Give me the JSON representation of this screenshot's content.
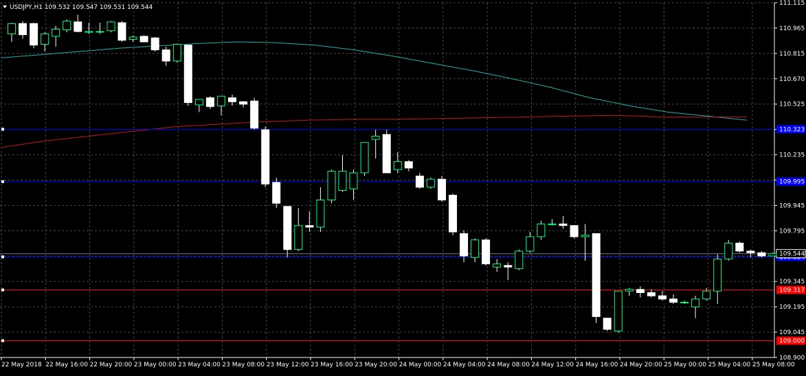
{
  "chart_title": "USDJPY,H1  109.532 109.547 109.531 109.544",
  "colors": {
    "background": "#000000",
    "grid": "#4a4a4a",
    "axis": "#ffffff",
    "text": "#ffffff",
    "bull_body": "#000000",
    "bull_border": "#00ff7f",
    "bear_body": "#ffffff",
    "bear_border": "#ffffff",
    "wick": "#ffffff",
    "ma_fast": "#20b2aa",
    "ma_slow": "#c01818",
    "blue_level": "#0000ff",
    "red_level": "#ff0000",
    "price_line": "#708090"
  },
  "chart_data": {
    "type": "candlestick",
    "symbol": "USDJPY",
    "timeframe": "H1",
    "title": "USDJPY,H1",
    "header_values": [
      "109.532",
      "109.547",
      "109.531",
      "109.544"
    ],
    "y_ticks": [
      "111.115",
      "110.965",
      "110.815",
      "110.670",
      "110.525",
      "110.380",
      "110.235",
      "110.090",
      "109.945",
      "109.795",
      "109.645",
      "109.345",
      "109.195",
      "109.045",
      "108.900"
    ],
    "ylim": [
      108.894,
      111.115
    ],
    "x_ticks": [
      "22 May 2018",
      "22 May 16:00",
      "22 May 20:00",
      "23 May 00:00",
      "23 May 04:00",
      "23 May 08:00",
      "23 May 12:00",
      "23 May 16:00",
      "23 May 20:00",
      "24 May 00:00",
      "24 May 04:00",
      "24 May 08:00",
      "24 May 12:00",
      "24 May 16:00",
      "24 May 20:00",
      "25 May 00:00",
      "25 May 04:00",
      "25 May 08:00"
    ],
    "candles": [
      {
        "o": 110.92,
        "h": 110.99,
        "l": 110.87,
        "c": 110.985
      },
      {
        "o": 110.985,
        "h": 111.0,
        "l": 110.89,
        "c": 110.915
      },
      {
        "o": 110.985,
        "h": 110.99,
        "l": 110.83,
        "c": 110.85
      },
      {
        "o": 110.855,
        "h": 110.93,
        "l": 110.81,
        "c": 110.92
      },
      {
        "o": 110.905,
        "h": 110.97,
        "l": 110.84,
        "c": 110.95
      },
      {
        "o": 110.945,
        "h": 111.01,
        "l": 110.93,
        "c": 111.0
      },
      {
        "o": 110.995,
        "h": 111.04,
        "l": 110.93,
        "c": 110.935
      },
      {
        "o": 110.93,
        "h": 110.99,
        "l": 110.92,
        "c": 110.935
      },
      {
        "o": 110.935,
        "h": 110.99,
        "l": 110.92,
        "c": 110.935
      },
      {
        "o": 110.94,
        "h": 111.0,
        "l": 110.93,
        "c": 110.995
      },
      {
        "o": 110.99,
        "h": 111.0,
        "l": 110.87,
        "c": 110.88
      },
      {
        "o": 110.885,
        "h": 110.91,
        "l": 110.87,
        "c": 110.9
      },
      {
        "o": 110.905,
        "h": 110.91,
        "l": 110.87,
        "c": 110.87
      },
      {
        "o": 110.895,
        "h": 110.9,
        "l": 110.81,
        "c": 110.82
      },
      {
        "o": 110.82,
        "h": 110.84,
        "l": 110.72,
        "c": 110.75
      },
      {
        "o": 110.75,
        "h": 110.86,
        "l": 110.74,
        "c": 110.855
      },
      {
        "o": 110.85,
        "h": 110.85,
        "l": 110.47,
        "c": 110.49
      },
      {
        "o": 110.475,
        "h": 110.51,
        "l": 110.43,
        "c": 110.51
      },
      {
        "o": 110.52,
        "h": 110.53,
        "l": 110.45,
        "c": 110.465
      },
      {
        "o": 110.47,
        "h": 110.53,
        "l": 110.41,
        "c": 110.53
      },
      {
        "o": 110.52,
        "h": 110.54,
        "l": 110.47,
        "c": 110.495
      },
      {
        "o": 110.495,
        "h": 110.5,
        "l": 110.46,
        "c": 110.48
      },
      {
        "o": 110.5,
        "h": 110.52,
        "l": 110.32,
        "c": 110.33
      },
      {
        "o": 110.32,
        "h": 110.34,
        "l": 109.96,
        "c": 109.98
      },
      {
        "o": 109.99,
        "h": 110.02,
        "l": 109.83,
        "c": 109.86
      },
      {
        "o": 109.84,
        "h": 109.84,
        "l": 109.52,
        "c": 109.57
      },
      {
        "o": 109.57,
        "h": 109.83,
        "l": 109.56,
        "c": 109.72
      },
      {
        "o": 109.72,
        "h": 109.81,
        "l": 109.68,
        "c": 109.71
      },
      {
        "o": 109.71,
        "h": 109.96,
        "l": 109.68,
        "c": 109.88
      },
      {
        "o": 109.88,
        "h": 110.07,
        "l": 109.86,
        "c": 110.06
      },
      {
        "o": 109.94,
        "h": 110.16,
        "l": 109.93,
        "c": 110.06
      },
      {
        "o": 109.95,
        "h": 110.07,
        "l": 109.88,
        "c": 110.05
      },
      {
        "o": 110.05,
        "h": 110.24,
        "l": 110.03,
        "c": 110.24
      },
      {
        "o": 110.26,
        "h": 110.32,
        "l": 110.14,
        "c": 110.28
      },
      {
        "o": 110.29,
        "h": 110.32,
        "l": 110.05,
        "c": 110.05
      },
      {
        "o": 110.07,
        "h": 110.18,
        "l": 110.05,
        "c": 110.12
      },
      {
        "o": 110.12,
        "h": 110.13,
        "l": 110.06,
        "c": 110.08
      },
      {
        "o": 110.03,
        "h": 110.05,
        "l": 109.95,
        "c": 109.96
      },
      {
        "o": 109.96,
        "h": 110.02,
        "l": 109.95,
        "c": 110.01
      },
      {
        "o": 110.01,
        "h": 110.03,
        "l": 109.87,
        "c": 109.88
      },
      {
        "o": 109.91,
        "h": 109.92,
        "l": 109.66,
        "c": 109.68
      },
      {
        "o": 109.67,
        "h": 109.69,
        "l": 109.49,
        "c": 109.53
      },
      {
        "o": 109.52,
        "h": 109.64,
        "l": 109.49,
        "c": 109.63
      },
      {
        "o": 109.63,
        "h": 109.64,
        "l": 109.47,
        "c": 109.48
      },
      {
        "o": 109.46,
        "h": 109.51,
        "l": 109.43,
        "c": 109.48
      },
      {
        "o": 109.47,
        "h": 109.49,
        "l": 109.38,
        "c": 109.46
      },
      {
        "o": 109.45,
        "h": 109.57,
        "l": 109.44,
        "c": 109.56
      },
      {
        "o": 109.56,
        "h": 109.68,
        "l": 109.55,
        "c": 109.65
      },
      {
        "o": 109.65,
        "h": 109.75,
        "l": 109.63,
        "c": 109.73
      },
      {
        "o": 109.73,
        "h": 109.76,
        "l": 109.72,
        "c": 109.73
      },
      {
        "o": 109.73,
        "h": 109.78,
        "l": 109.7,
        "c": 109.72
      },
      {
        "o": 109.72,
        "h": 109.72,
        "l": 109.64,
        "c": 109.65
      },
      {
        "o": 109.65,
        "h": 109.73,
        "l": 109.5,
        "c": 109.66
      },
      {
        "o": 109.67,
        "h": 109.67,
        "l": 109.11,
        "c": 109.15
      },
      {
        "o": 109.14,
        "h": 109.14,
        "l": 109.06,
        "c": 109.07
      },
      {
        "o": 109.06,
        "h": 109.31,
        "l": 109.05,
        "c": 109.31
      },
      {
        "o": 109.31,
        "h": 109.33,
        "l": 109.28,
        "c": 109.32
      },
      {
        "o": 109.32,
        "h": 109.34,
        "l": 109.27,
        "c": 109.3
      },
      {
        "o": 109.3,
        "h": 109.32,
        "l": 109.27,
        "c": 109.28
      },
      {
        "o": 109.28,
        "h": 109.31,
        "l": 109.25,
        "c": 109.26
      },
      {
        "o": 109.26,
        "h": 109.29,
        "l": 109.23,
        "c": 109.24
      },
      {
        "o": 109.24,
        "h": 109.25,
        "l": 109.23,
        "c": 109.24
      },
      {
        "o": 109.21,
        "h": 109.28,
        "l": 109.14,
        "c": 109.26
      },
      {
        "o": 109.26,
        "h": 109.33,
        "l": 109.25,
        "c": 109.31
      },
      {
        "o": 109.31,
        "h": 109.54,
        "l": 109.23,
        "c": 109.51
      },
      {
        "o": 109.51,
        "h": 109.63,
        "l": 109.5,
        "c": 109.61
      },
      {
        "o": 109.61,
        "h": 109.62,
        "l": 109.55,
        "c": 109.56
      },
      {
        "o": 109.56,
        "h": 109.57,
        "l": 109.52,
        "c": 109.55
      },
      {
        "o": 109.55,
        "h": 109.56,
        "l": 109.52,
        "c": 109.53
      },
      {
        "o": 109.53,
        "h": 109.55,
        "l": 109.53,
        "c": 109.544
      }
    ],
    "series": [
      {
        "values": [
          110.77,
          110.79,
          110.81,
          110.83,
          110.845,
          110.86,
          110.87,
          110.865,
          110.85,
          110.82,
          110.78,
          110.735,
          110.69,
          110.64,
          110.585,
          110.52,
          110.47,
          110.43,
          110.405,
          110.38
        ]
      },
      {
        "values": [
          110.21,
          110.25,
          110.28,
          110.31,
          110.34,
          110.355,
          110.37,
          110.38,
          110.385,
          110.385,
          110.39,
          110.395,
          110.4,
          110.405,
          110.41,
          110.4,
          110.4,
          110.4
        ]
      }
    ],
    "horizontal_levels": [
      {
        "price": 110.323,
        "color": "blue",
        "label": "110.323"
      },
      {
        "price": 109.995,
        "color": "blue",
        "label": "109.995"
      },
      {
        "price": 109.524,
        "color": "blue",
        "label": "109.524"
      },
      {
        "price": 109.317,
        "color": "red",
        "label": "109.317"
      },
      {
        "price": 108.999,
        "color": "red",
        "label": "109.000"
      }
    ],
    "current_price": {
      "price": 109.544,
      "label": "109.544"
    },
    "grid": true
  }
}
